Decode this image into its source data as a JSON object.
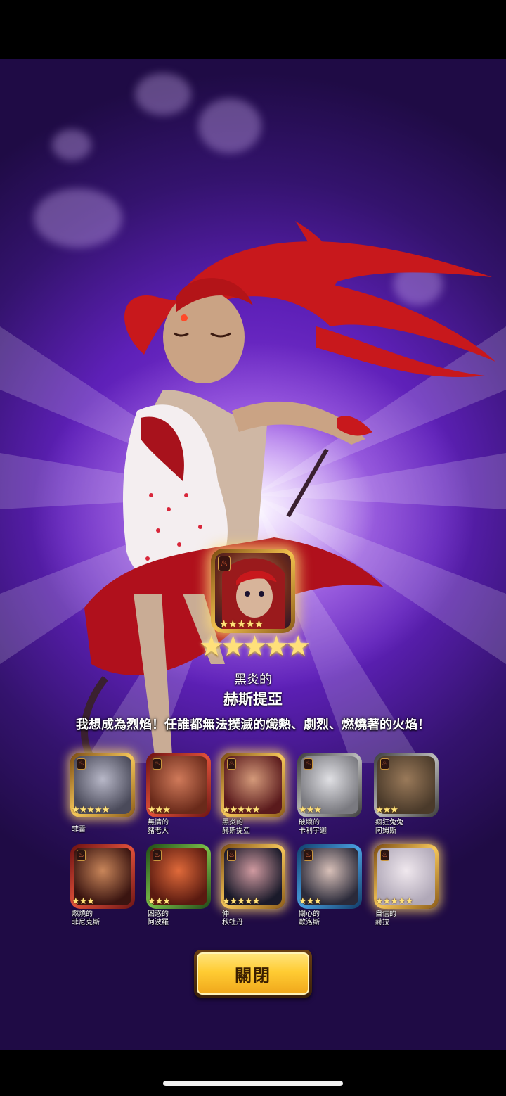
{
  "summon_result": {
    "featured": {
      "epithet": "黑炎的",
      "name": "赫斯提亞",
      "quote": "我想成為烈焰！任誰都無法撲滅的熾熱、劇烈、燃燒著的火焰！",
      "rarity_stars": 5,
      "big_stars": "★★★★★",
      "card_stars": "★★★★★"
    },
    "heroes": [
      {
        "line1": "菲雷",
        "line2": "",
        "stars": "★★★★★",
        "frame": "gold",
        "glow": true
      },
      {
        "line1": "無情的",
        "line2": "豬老大",
        "stars": "★★★",
        "frame": "red",
        "glow": false
      },
      {
        "line1": "黑炎的",
        "line2": "赫斯提亞",
        "stars": "★★★★★",
        "frame": "gold",
        "glow": true
      },
      {
        "line1": "破壞的",
        "line2": "卡利宇迦",
        "stars": "★★★",
        "frame": "grey",
        "glow": false
      },
      {
        "line1": "瘋狂兔兔",
        "line2": "阿姆斯",
        "stars": "★★★",
        "frame": "grey",
        "glow": false
      },
      {
        "line1": "燃燒的",
        "line2": "菲尼克斯",
        "stars": "★★★",
        "frame": "red",
        "glow": false
      },
      {
        "line1": "困惑的",
        "line2": "阿波羅",
        "stars": "★★★",
        "frame": "green",
        "glow": false
      },
      {
        "line1": "仲",
        "line2": "秋牡丹",
        "stars": "★★★★★",
        "frame": "gold",
        "glow": true
      },
      {
        "line1": "關心的",
        "line2": "歐洛斯",
        "stars": "★★★",
        "frame": "blue",
        "glow": false
      },
      {
        "line1": "自信的",
        "line2": "赫拉",
        "stars": "★★★★★",
        "frame": "gold",
        "glow": true
      }
    ]
  },
  "close_button_label": "關閉",
  "icons": {
    "element": "fire-element-icon",
    "star": "star-icon"
  },
  "colors": {
    "background_purple": "#5e20b8",
    "gold_frame": "#f6c75a",
    "button_yellow": "#ffcc33",
    "hair_red": "#c8181c"
  }
}
